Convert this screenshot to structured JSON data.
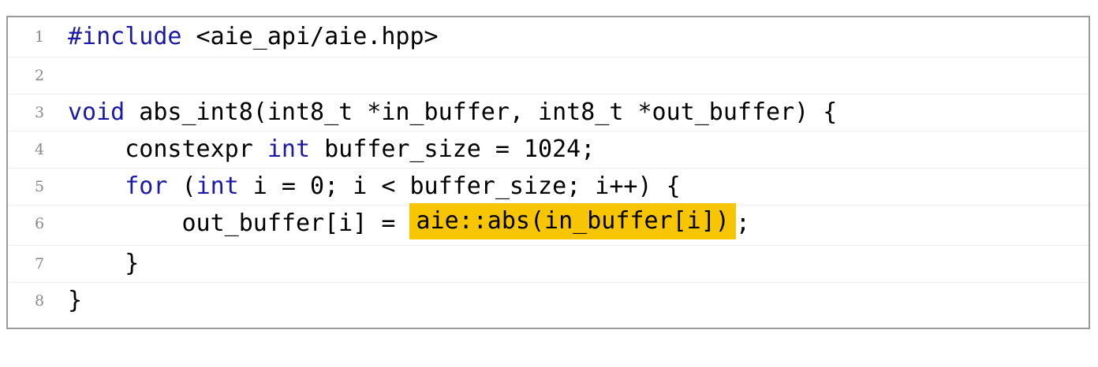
{
  "code": {
    "lines": [
      {
        "number": "1",
        "parts": [
          {
            "t": "#include",
            "kw": true
          },
          {
            "t": " <aie_api/aie.hpp>"
          }
        ]
      },
      {
        "number": "2",
        "parts": []
      },
      {
        "number": "3",
        "parts": [
          {
            "t": "void",
            "kw": true
          },
          {
            "t": " abs_int8(int8_t *in_buffer, int8_t *out_buffer) {"
          }
        ]
      },
      {
        "number": "4",
        "parts": [
          {
            "t": "    constexpr "
          },
          {
            "t": "int",
            "kw": true
          },
          {
            "t": " buffer_size = 1024;"
          }
        ]
      },
      {
        "number": "5",
        "parts": [
          {
            "t": "    "
          },
          {
            "t": "for",
            "kw": true
          },
          {
            "t": " ("
          },
          {
            "t": "int",
            "kw": true
          },
          {
            "t": " i = 0; i < buffer_size; i++) {"
          }
        ]
      },
      {
        "number": "6",
        "parts": [
          {
            "t": "        out_buffer[i] = "
          },
          {
            "t": "aie::abs(in_buffer[i])",
            "hl": true
          },
          {
            "t": ";"
          }
        ]
      },
      {
        "number": "7",
        "parts": [
          {
            "t": "    }"
          }
        ]
      },
      {
        "number": "8",
        "parts": [
          {
            "t": "}"
          }
        ]
      }
    ],
    "colors": {
      "keyword": "#1a1aa6",
      "highlight": "#f8c600",
      "line_number": "#8a8a8a",
      "border": "#9a9a9a"
    }
  }
}
